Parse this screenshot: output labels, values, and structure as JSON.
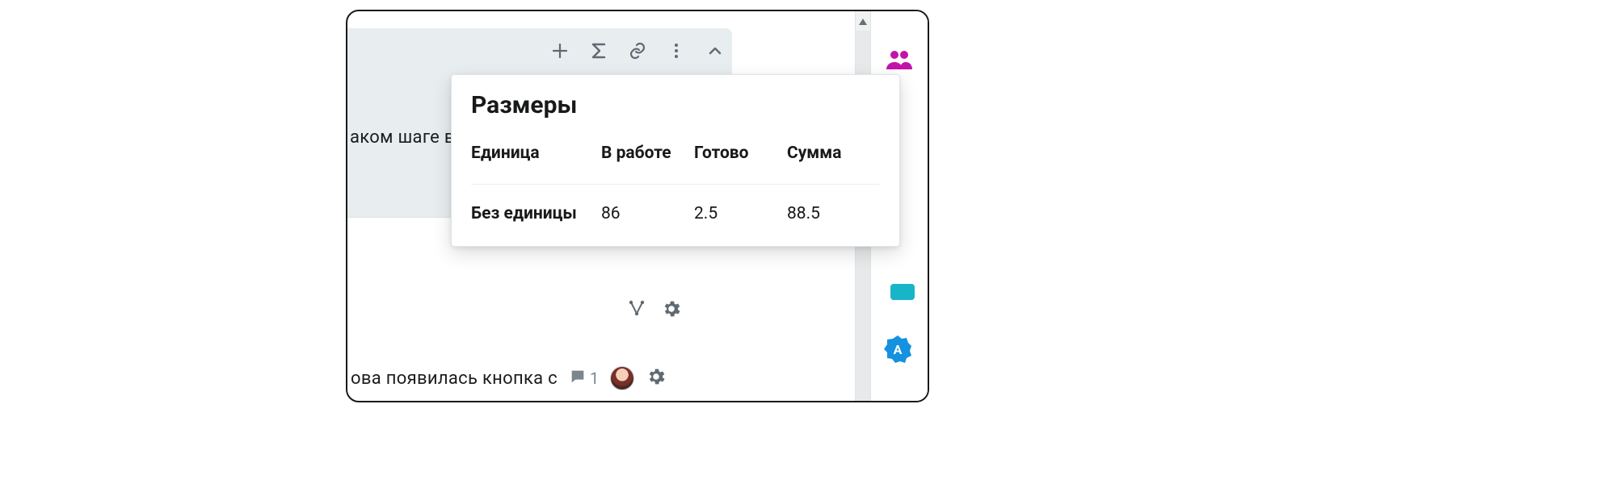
{
  "background": {
    "fragment_top": "аком шаге в",
    "fragment_bottom": "ова появилась кнопка с",
    "comment_count": "1"
  },
  "toolbar": {
    "icons": {
      "add": "plus-icon",
      "sigma": "sigma-icon",
      "link": "link-icon",
      "more": "more-vertical-icon",
      "collapse": "chevron-up-icon"
    }
  },
  "popover": {
    "title": "Размеры",
    "columns": {
      "unit": "Единица",
      "in_progress": "В работе",
      "done": "Готово",
      "total": "Сумма"
    },
    "rows": [
      {
        "label": "Без единицы",
        "in_progress": "86",
        "done": "2.5",
        "total": "88.5"
      }
    ]
  },
  "rightbar": {
    "people": "people-icon",
    "badge_letter": "A"
  },
  "colors": {
    "accent_magenta": "#c214a8",
    "accent_teal": "#18b5c9",
    "badge_blue": "#1591e0"
  }
}
